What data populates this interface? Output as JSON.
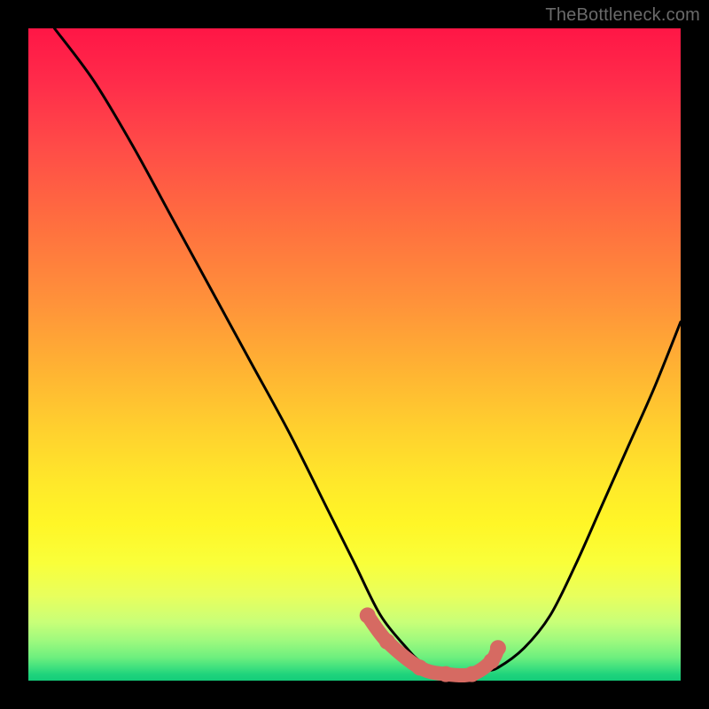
{
  "watermark": "TheBottleneck.com",
  "colors": {
    "frame_bg": "#000000",
    "curve_stroke": "#000000",
    "marker_fill": "#d66a62",
    "gradient_top": "#ff1646",
    "gradient_bottom": "#14cc7a"
  },
  "chart_data": {
    "type": "line",
    "title": "",
    "xlabel": "",
    "ylabel": "",
    "xlim": [
      0,
      100
    ],
    "ylim": [
      0,
      100
    ],
    "x": [
      4,
      10,
      16,
      22,
      28,
      34,
      40,
      46,
      50,
      54,
      58,
      60,
      62,
      64,
      66,
      68,
      70,
      72,
      76,
      80,
      84,
      88,
      92,
      96,
      100
    ],
    "values": [
      100,
      92,
      82,
      71,
      60,
      49,
      38,
      26,
      18,
      10,
      5,
      3,
      2,
      1.5,
      1.2,
      1.2,
      1.5,
      2,
      5,
      10,
      18,
      27,
      36,
      45,
      55
    ],
    "markers": {
      "x": [
        52,
        55,
        60,
        64,
        68,
        71,
        72
      ],
      "y": [
        10,
        6,
        2,
        1,
        1,
        3,
        5
      ]
    }
  }
}
